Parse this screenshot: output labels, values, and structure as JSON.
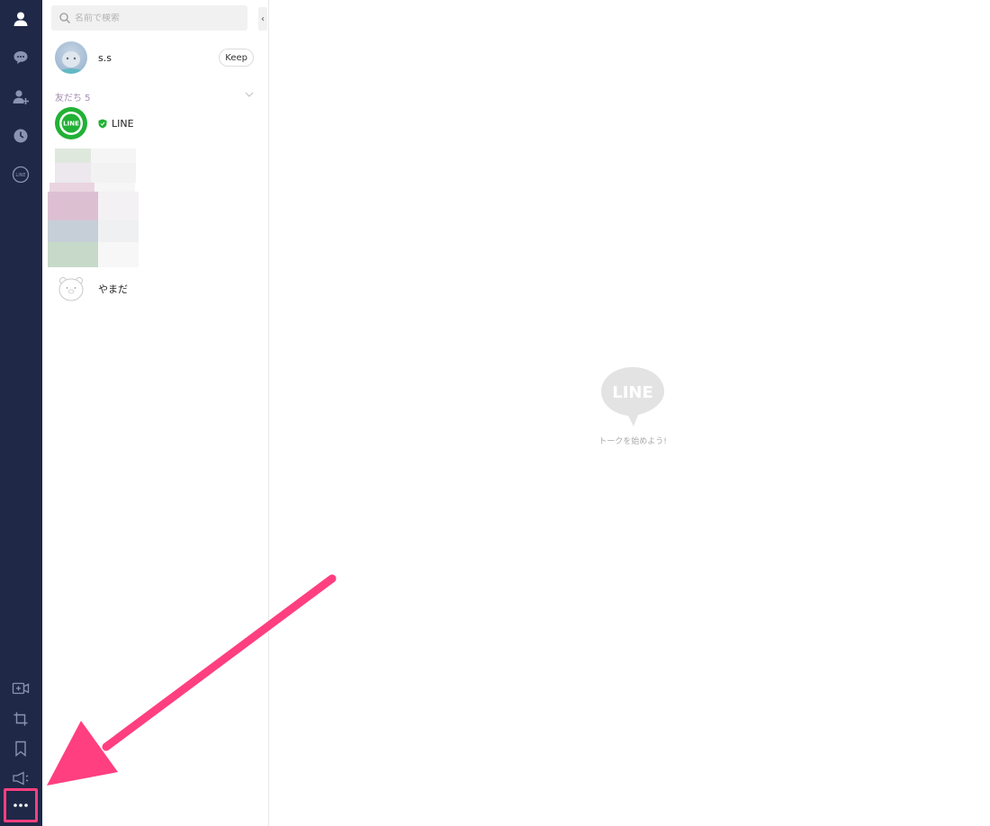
{
  "search": {
    "placeholder": "名前で検索"
  },
  "profile": {
    "name": "s.s",
    "keep_label": "Keep"
  },
  "friends": {
    "header": "友だち 5",
    "official_name": "LINE",
    "official_avatar_text": "LINE",
    "last_name": "やまだ"
  },
  "main": {
    "logo_text": "LINE",
    "empty_message": "トークを始めよう!"
  },
  "rail": {
    "top_icons": [
      "person-icon",
      "chat-icon",
      "add-friend-icon",
      "clock-icon",
      "line-icon"
    ],
    "bottom_icons": [
      "video-plus-icon",
      "crop-icon",
      "bookmark-icon",
      "megaphone-icon",
      "more-icon"
    ]
  },
  "colors": {
    "rail": "#1f2847",
    "accent": "#ff3f7f",
    "line_green": "#06c755"
  }
}
